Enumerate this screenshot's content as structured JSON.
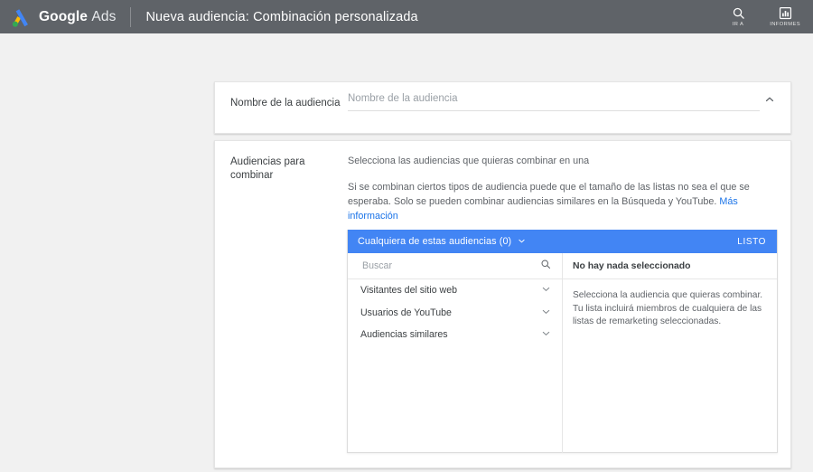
{
  "topbar": {
    "brand_main": "Google",
    "brand_sub": "Ads",
    "logo_icon": "google-ads-logo-icon",
    "page_title": "Nueva audiencia: Combinación personalizada",
    "actions": [
      {
        "icon": "search-icon",
        "label": "IR A"
      },
      {
        "icon": "reports-bar-chart-icon",
        "label": "INFORMES"
      }
    ]
  },
  "audience_name_card": {
    "label": "Nombre de la audiencia",
    "input_value": "",
    "input_placeholder": "Nombre de la audiencia",
    "collapse_icon": "chevron-up-icon"
  },
  "combine_card": {
    "label": "Audiencias para combinar",
    "intro": "Selecciona las audiencias que quieras combinar en una",
    "description": "Si se combinan ciertos tipos de audiencia puede que el tamaño de las listas no sea el que se esperaba. Solo se pueden combinar audiencias similares en la Búsqueda y YouTube.",
    "learn_more": "Más información",
    "selector": {
      "header_title": "Cualquiera de estas audiencias (0)",
      "header_caret_icon": "chevron-down-icon",
      "done_label": "LISTO",
      "search_placeholder": "Buscar",
      "search_value": "",
      "search_icon": "search-icon",
      "items": [
        {
          "label": "Visitantes del sitio web",
          "caret_icon": "chevron-down-icon"
        },
        {
          "label": "Usuarios de YouTube",
          "caret_icon": "chevron-down-icon"
        },
        {
          "label": "Audiencias similares",
          "caret_icon": "chevron-down-icon"
        }
      ],
      "empty_title": "No hay nada seleccionado",
      "empty_body": "Selecciona la audiencia que quieras combinar. Tu lista incluirá miembros de cualquiera de las listas de remarketing seleccionadas."
    }
  },
  "colors": {
    "topbar_bg": "#5f6368",
    "accent_blue": "#4285f4",
    "link_blue": "#1a73e8",
    "page_bg": "#f1f1f1",
    "card_bg": "#ffffff",
    "text_primary": "#3c4043",
    "text_secondary": "#5f6368"
  }
}
